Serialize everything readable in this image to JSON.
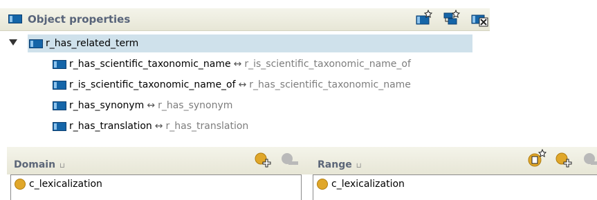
{
  "object_properties": {
    "title": "Object properties",
    "tree": {
      "root": {
        "label": "r_has_related_term",
        "expanded": true
      },
      "children": [
        {
          "label": "r_has_scientific_taxonomic_name",
          "arrow": "↔",
          "inverse": "r_is_scientific_taxonomic_name_of"
        },
        {
          "label": "r_is_scientific_taxonomic_name_of",
          "arrow": "↔",
          "inverse": "r_has_scientific_taxonomic_name"
        },
        {
          "label": "r_has_synonym",
          "arrow": "↔",
          "inverse": "r_has_synonym"
        },
        {
          "label": "r_has_translation",
          "arrow": "↔",
          "inverse": "r_has_translation"
        }
      ]
    }
  },
  "domain": {
    "title": "Domain",
    "tag_glyph": "⊔",
    "items": [
      "c_lexicalization"
    ]
  },
  "range": {
    "title": "Range",
    "tag_glyph": "⊔",
    "items": [
      "c_lexicalization"
    ]
  },
  "colors": {
    "property_icon": "#1565a8",
    "class_icon": "#e0a72a",
    "selection": "#cfe1eb",
    "header_text": "#58647a"
  }
}
